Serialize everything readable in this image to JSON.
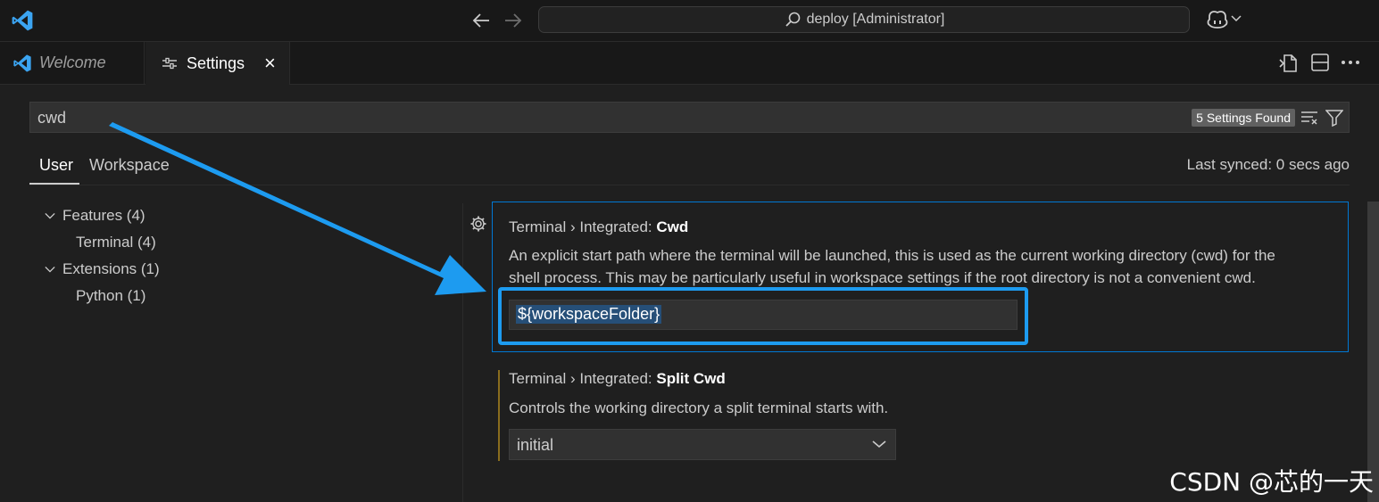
{
  "titlebar": {
    "command_center_text": "deploy [Administrator]",
    "icons": [
      "vscode-logo",
      "arrow-left",
      "arrow-right",
      "search",
      "copilot",
      "chevron-down"
    ]
  },
  "tabs": [
    {
      "label": "Welcome",
      "icon": "vscode-logo",
      "active": false
    },
    {
      "label": "Settings",
      "icon": "settings-sliders",
      "active": true,
      "close": "×"
    }
  ],
  "editor_actions": [
    "open-settings-json-icon",
    "split-editor-icon",
    "more-actions-icon"
  ],
  "search": {
    "value": "cwd",
    "result_count": "5 Settings Found"
  },
  "scopes": {
    "user": "User",
    "workspace": "Workspace",
    "last_synced": "Last synced: 0 secs ago"
  },
  "toc": [
    {
      "label": "Features (4)",
      "expanded": true,
      "level": 0
    },
    {
      "label": "Terminal (4)",
      "level": 1
    },
    {
      "label": "Extensions (1)",
      "expanded": true,
      "level": 0
    },
    {
      "label": "Python (1)",
      "level": 1
    }
  ],
  "settings": [
    {
      "category": "Terminal › Integrated: ",
      "name": "Cwd",
      "description_line1": "An explicit start path where the terminal will be launched, this is used as the current working directory (cwd) for the",
      "description_line2": "shell process. This may be particularly useful in workspace settings if the root directory is not a convenient cwd.",
      "value": "${workspaceFolder}"
    },
    {
      "category": "Terminal › Integrated: ",
      "name": "Split Cwd",
      "description": "Controls the working directory a split terminal starts with.",
      "value": "initial"
    }
  ],
  "watermark": "CSDN @芯的一天",
  "colors": {
    "accent": "#0078d4",
    "annotation": "#1d9bf0",
    "modified_bar": "#8a6d1e"
  }
}
